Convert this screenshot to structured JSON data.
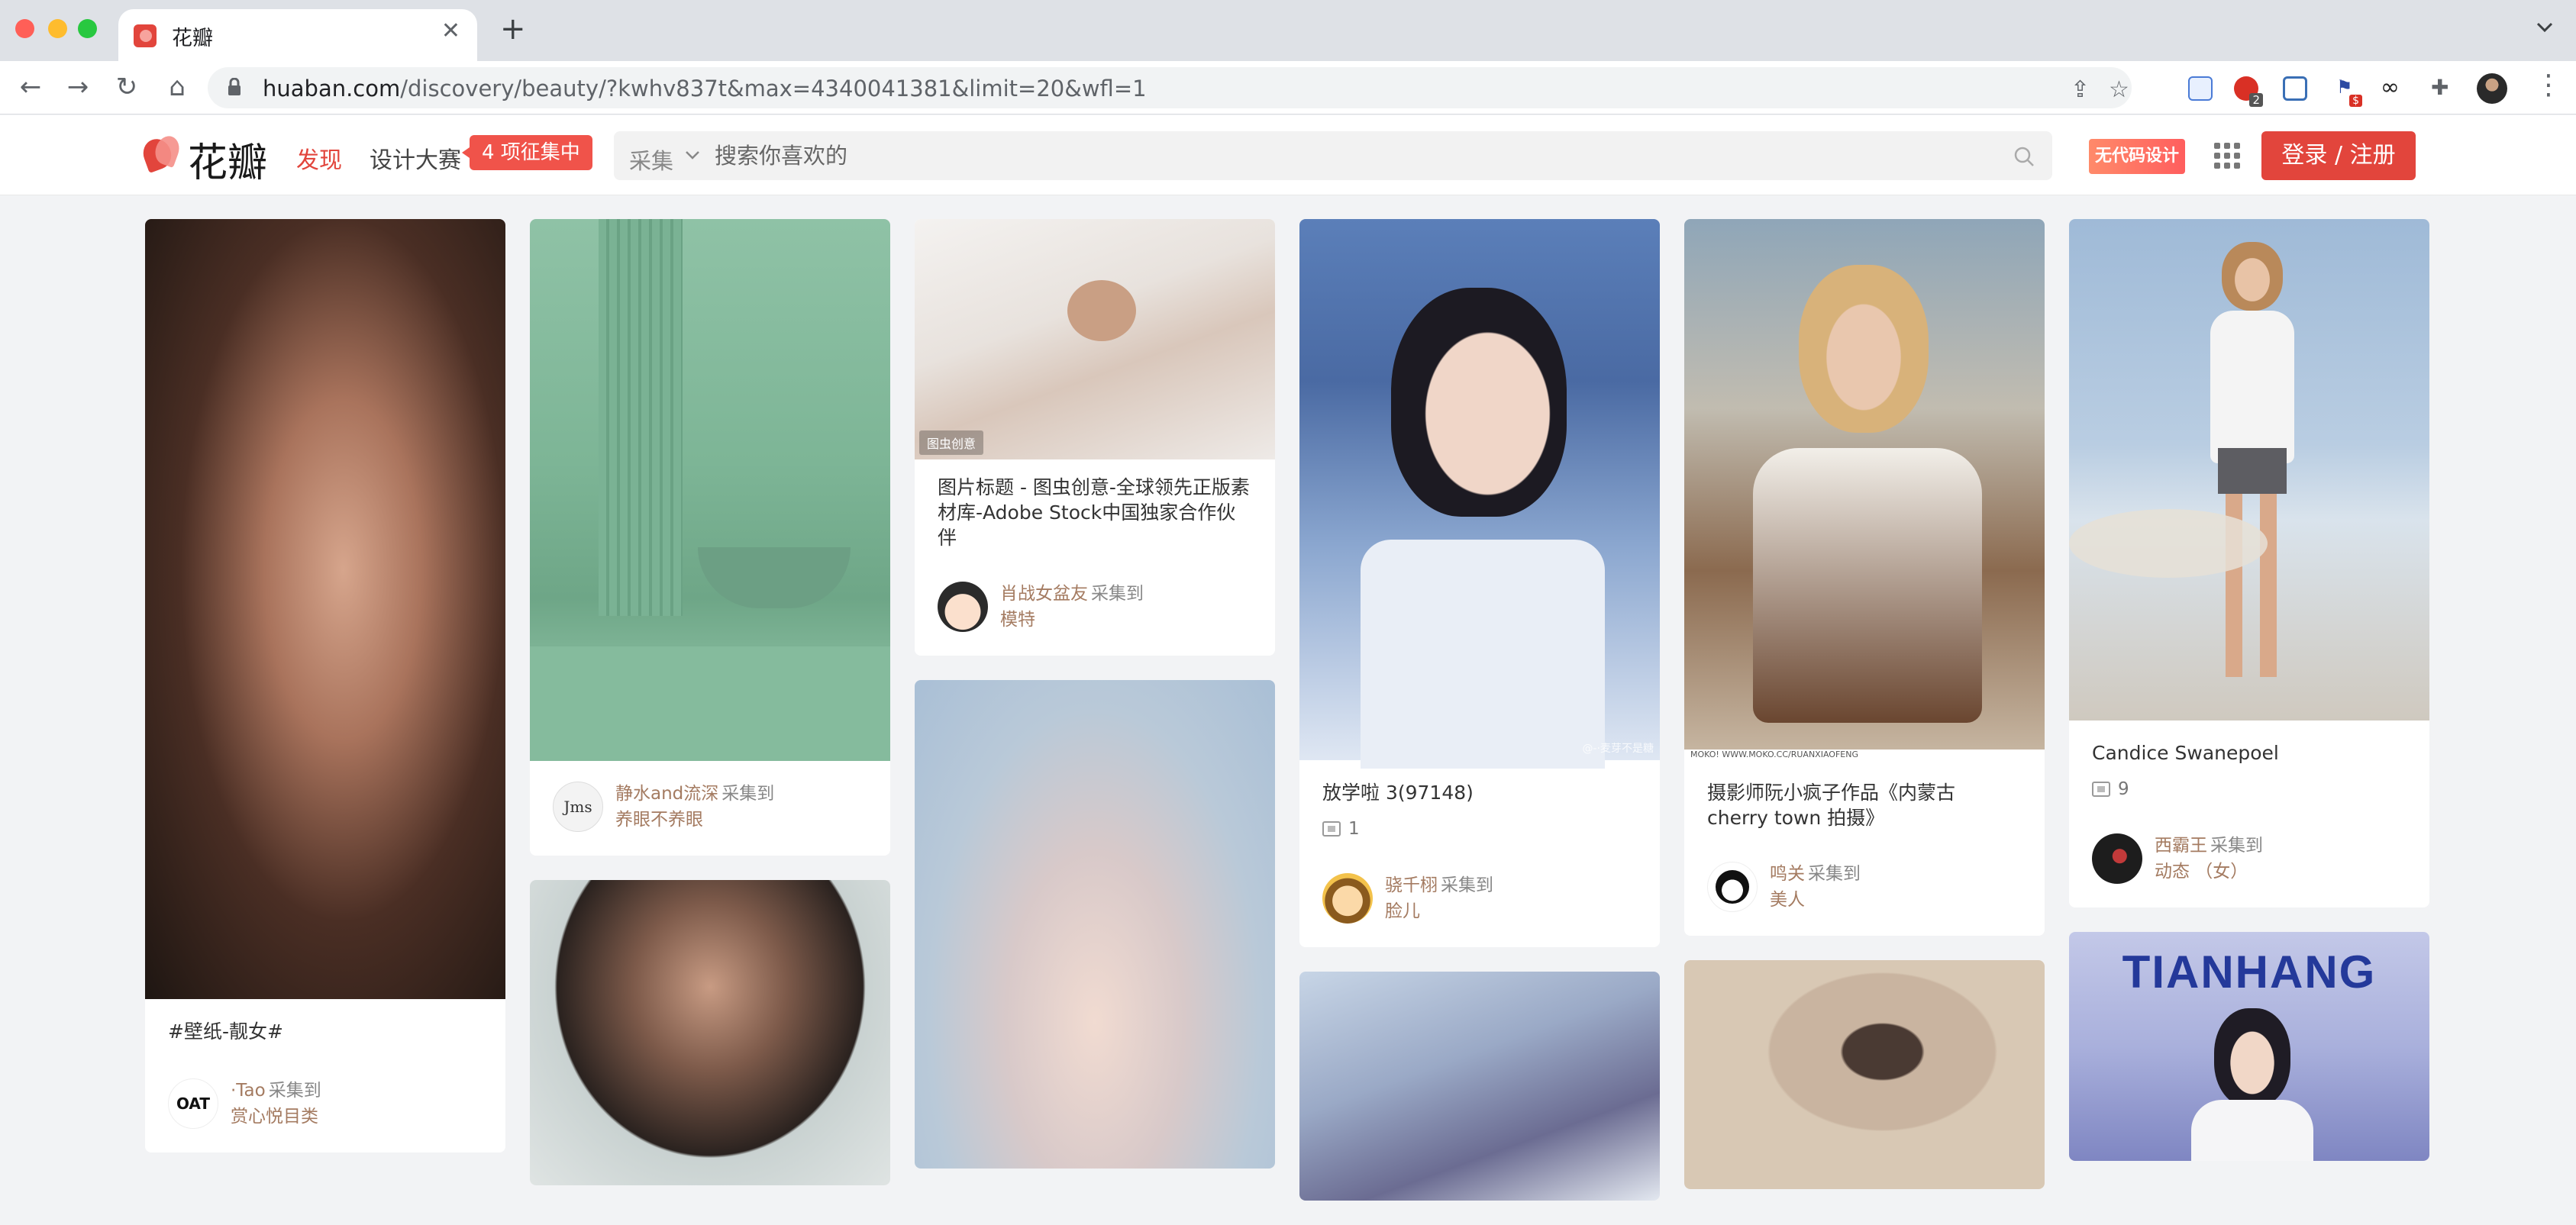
{
  "browser": {
    "tab_title": "花瓣",
    "url_host": "huaban.com",
    "url_path": "/discovery/beauty/?kwhv837t&max=4340041381&limit=20&wfl=1",
    "ext_badge_count": "2",
    "ext_badge_dollar": "$"
  },
  "header": {
    "logo_text": "花瓣",
    "nav_discover": "发现",
    "nav_contest": "设计大赛",
    "contest_badge": "4 项征集中",
    "search_scope": "采集",
    "search_placeholder": "搜索你喜欢的",
    "nocode_badge": "无代码设计",
    "login_label": "登录 / 注册"
  },
  "colors": {
    "brand": "#e2453c",
    "saver_link": "#a47b61"
  },
  "cards": [
    {
      "title": "#壁纸-靓女#",
      "saver": "·Tao",
      "verb": "采集到",
      "board": "赏心悦目类",
      "avatar_text": "OAT"
    },
    {
      "saver": "静水and流深",
      "verb": "采集到",
      "board": "养眼不养眼",
      "avatar_text": "Jms"
    },
    {
      "title": "图片标题 - 图虫创意-全球领先正版素材库-Adobe Stock中国独家合作伙伴",
      "saver": "肖战女盆友",
      "verb": "采集到",
      "board": "模特",
      "watermark": "图虫创意"
    },
    {
      "title": "放学啦 3(97148)",
      "repins": "1",
      "saver": "骁千栩",
      "verb": "采集到",
      "board": "脸儿",
      "watermark": "@-·麦芽不是糖"
    },
    {
      "title": "摄影师阮小疯子作品《内蒙古 cherry town 拍摄》",
      "saver": "鸣关",
      "verb": "采集到",
      "board": "美人",
      "caption": "MOKO! WWW.MOKO.CC/RUANXIAOFENG"
    },
    {
      "title": "Candice Swanepoel",
      "repins": "9",
      "saver": "西霸王",
      "verb": "采集到",
      "board": "动态 （女）"
    },
    {
      "poster_text": "TIANHANG"
    }
  ]
}
